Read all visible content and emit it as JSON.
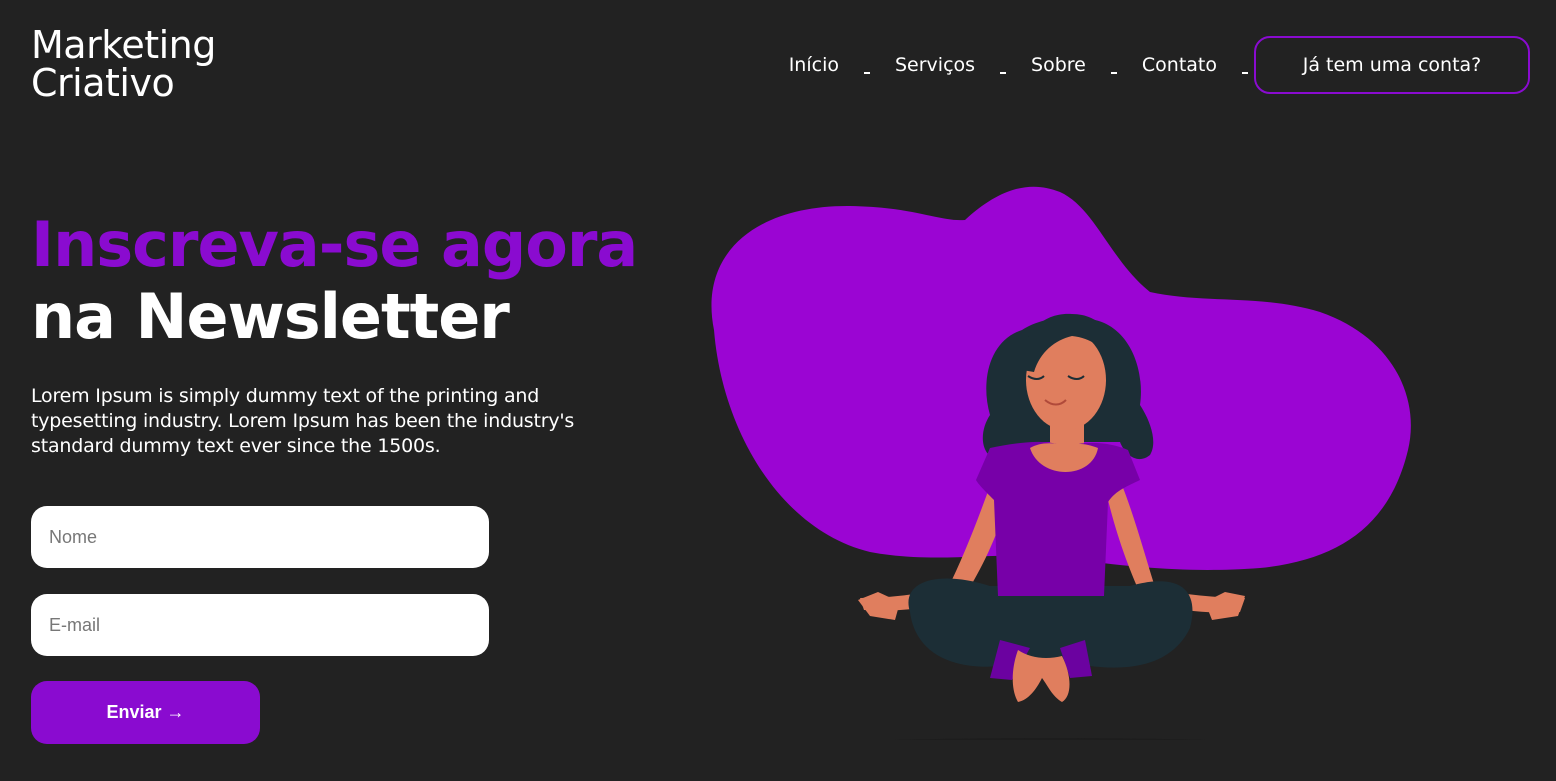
{
  "brand": {
    "line1": "Marketing",
    "line2": "Criativo"
  },
  "nav": {
    "items": [
      {
        "label": "Início"
      },
      {
        "label": "Serviços"
      },
      {
        "label": "Sobre"
      },
      {
        "label": "Contato"
      }
    ],
    "account_label": "Já tem uma conta?"
  },
  "hero": {
    "headline_accent": "Inscreva-se agora",
    "headline_main": "na Newsletter",
    "description": "Lorem Ipsum is simply dummy text of the printing and typesetting industry. Lorem Ipsum has been the industry's standard dummy text ever since the 1500s."
  },
  "form": {
    "name_placeholder": "Nome",
    "email_placeholder": "E-mail",
    "submit_label": "Enviar →"
  },
  "illustration": {
    "icon": "meditating-woman-illustration"
  },
  "colors": {
    "background": "#222222",
    "accent": "#8a0bd0",
    "blob": "#9b05d3",
    "text": "#ffffff"
  }
}
